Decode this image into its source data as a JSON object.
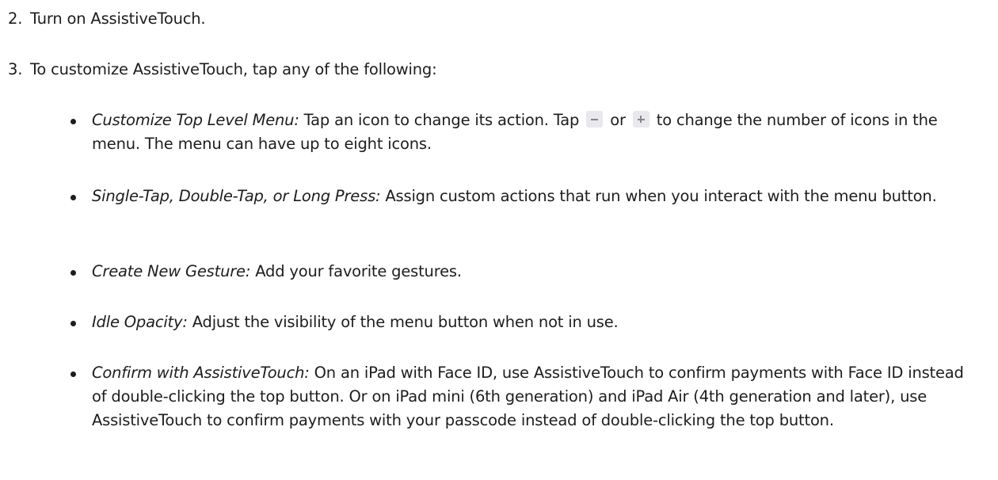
{
  "steps": [
    {
      "number": "2.",
      "text": "Turn on AssistiveTouch."
    },
    {
      "number": "3.",
      "text": "To customize AssistiveTouch, tap any of the following:"
    }
  ],
  "bullets": [
    {
      "term": "Customize Top Level Menu:",
      "text_a": " Tap an icon to change its action. Tap ",
      "text_b": " or ",
      "text_c": " to change the number of icons in the menu. The menu can have up to eight icons."
    },
    {
      "term": "Single-Tap, Double-Tap, or Long Press:",
      "text": " Assign custom actions that run when you interact with the menu button."
    },
    {
      "term": "Create New Gesture:",
      "text": " Add your favorite gestures."
    },
    {
      "term": "Idle Opacity:",
      "text": " Adjust the visibility of the menu button when not in use."
    },
    {
      "term": "Confirm with AssistiveTouch:",
      "text": " On an iPad with Face ID, use AssistiveTouch to confirm payments with Face ID instead of double-clicking the top button. Or on iPad mini (6th generation) and iPad Air (4th generation and later), use AssistiveTouch to confirm payments with your passcode instead of double-clicking the top button."
    }
  ],
  "icons": {
    "remove": "minus-icon",
    "add": "plus-icon"
  },
  "colors": {
    "text": "#1d1d1f",
    "icon_bg": "#e8e8ed",
    "icon_fg": "#86868b"
  }
}
